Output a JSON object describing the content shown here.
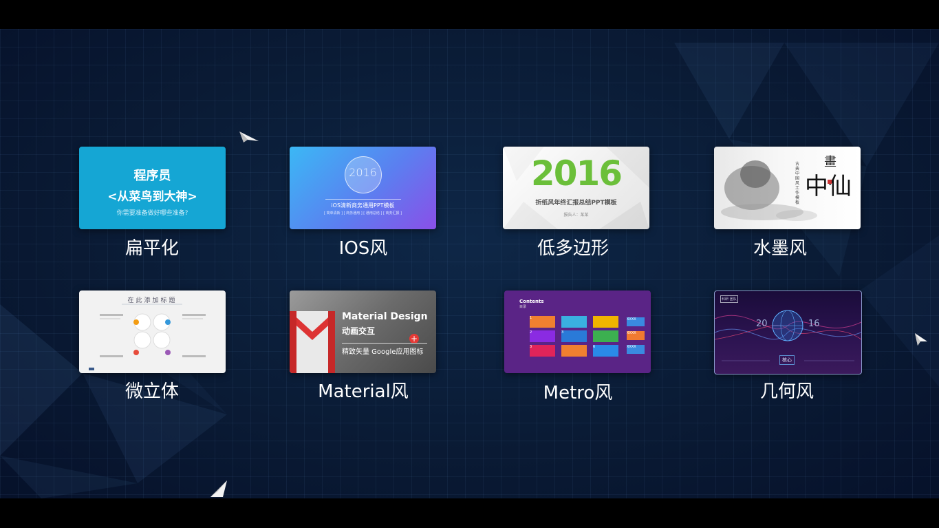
{
  "cards": [
    {
      "name": "flat",
      "label": "扁平化",
      "preview": {
        "line1": "程序员",
        "line2": "<从菜鸟到大神>",
        "line3": "你需要准备做好哪些准备?"
      }
    },
    {
      "name": "ios",
      "label": "IOS风",
      "preview": {
        "year": "2016",
        "line1": "iOS清新商务通用PPT模板",
        "line2": "[ 简单清新 ] [ 商务通用 ] [ 通用总结 ] [ 商务汇报 ]"
      }
    },
    {
      "name": "low-poly",
      "label": "低多边形",
      "preview": {
        "year": "2016",
        "line1": "折纸风年终汇报总结PPT模板",
        "line2": "报告人：某某"
      }
    },
    {
      "name": "ink",
      "label": "水墨风",
      "preview": {
        "big": "中仙",
        "top": "畫",
        "vertical": "古典中国风工作模板"
      }
    },
    {
      "name": "micro-3d",
      "label": "微立体",
      "preview": {
        "title": "在此添加标题"
      }
    },
    {
      "name": "material",
      "label": "Material风",
      "preview": {
        "line1": "Material Design",
        "line2": "动画交互",
        "line3": "精致矢量 Google应用图标"
      }
    },
    {
      "name": "metro",
      "label": "Metro风",
      "preview": {
        "header": "Contents",
        "sub": "目录",
        "tiles": [
          "1",
          "",
          "",
          "",
          "2",
          "3",
          "",
          "",
          "3",
          "",
          "",
          "6"
        ],
        "side": [
          "XXXX",
          "XXXX",
          "XXXX"
        ]
      }
    },
    {
      "name": "geometric",
      "label": "几何风",
      "preview": {
        "year_left": "20",
        "year_right": "16",
        "tag": "科研 团队",
        "core": "核心"
      }
    }
  ],
  "colors": {
    "background": "#0a1b35",
    "label": "#ffffff",
    "flat": "#15a6d4",
    "metro": "#5a2486"
  }
}
